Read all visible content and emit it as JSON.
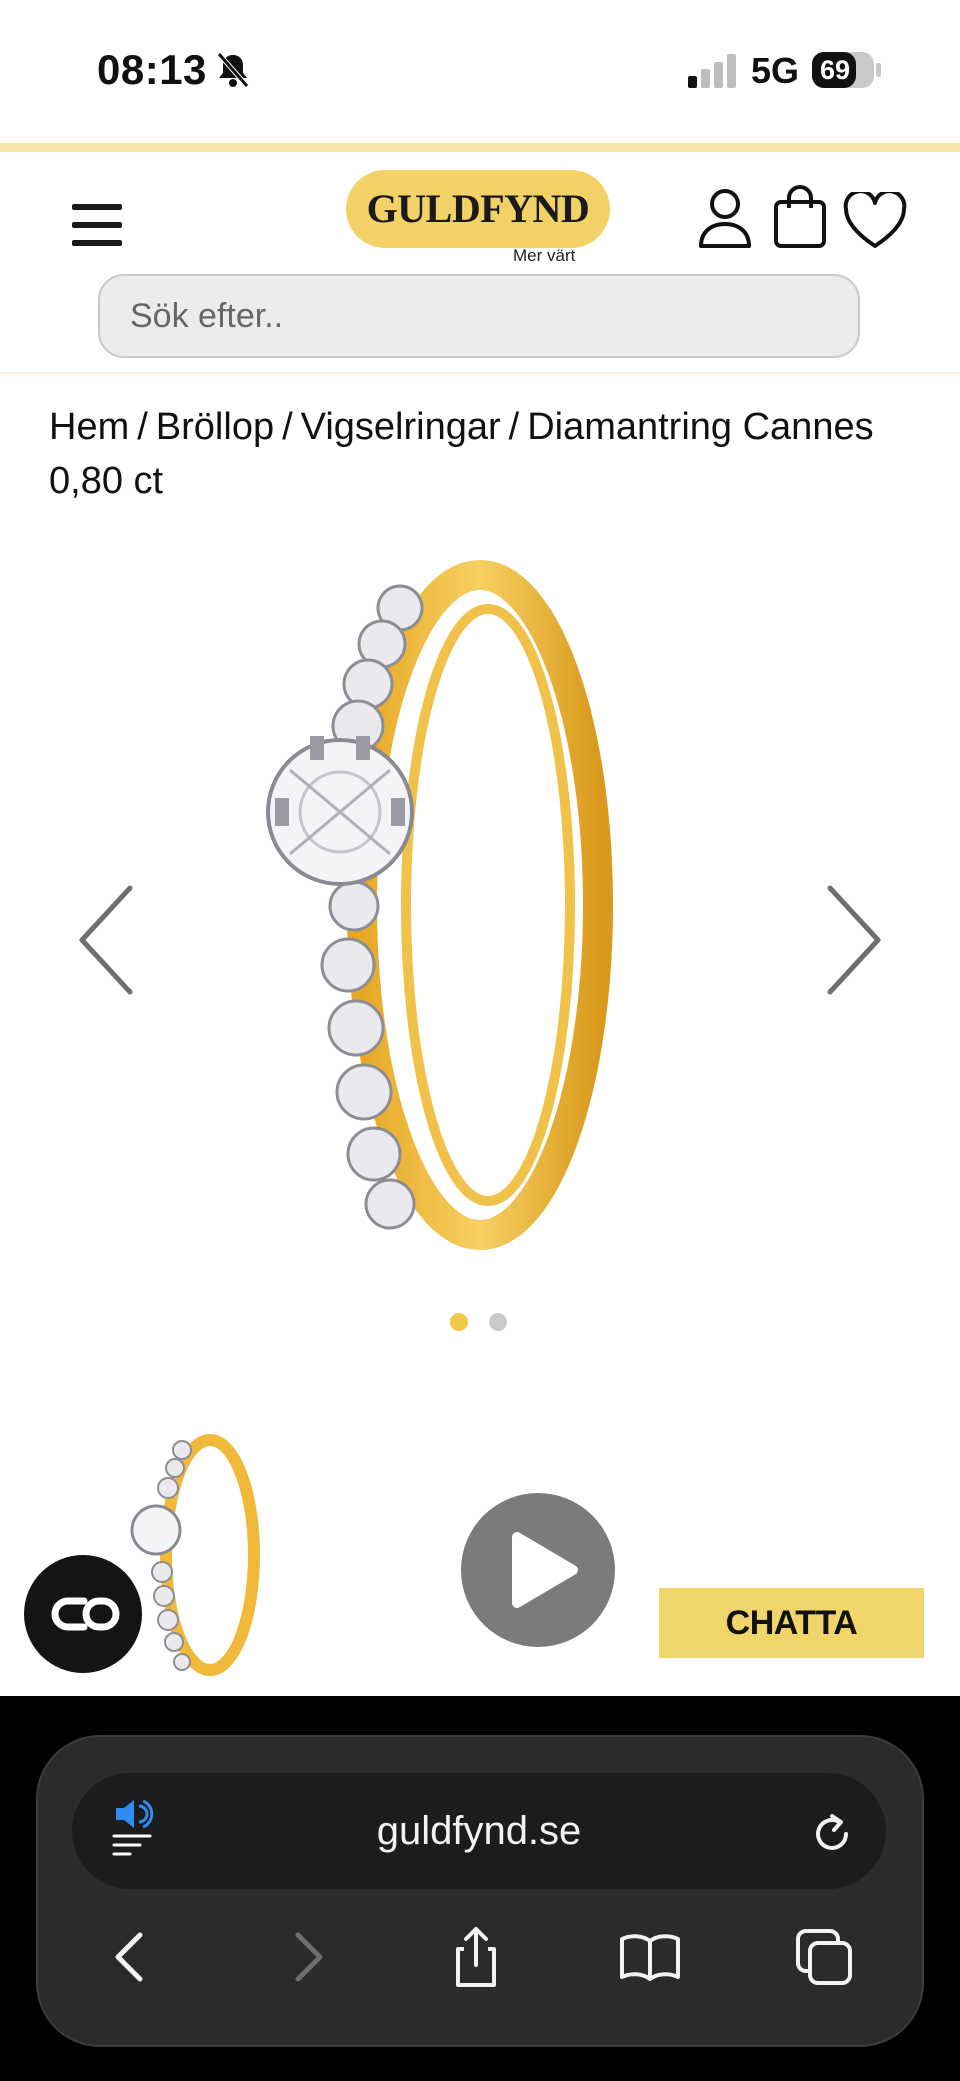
{
  "status_bar": {
    "time": "08:13",
    "network": "5G",
    "battery": "69"
  },
  "header": {
    "logo_text": "GULDFYND",
    "tagline": "Mer värt",
    "search_placeholder": "Sök efter.."
  },
  "breadcrumb": {
    "items": [
      "Hem",
      "Bröllop",
      "Vigselringar"
    ],
    "current": "Diamantring Cannes 0,80 ct",
    "separator": "/"
  },
  "gallery": {
    "slide_count": 2,
    "active_slide": 1
  },
  "chat": {
    "button_label": "CHATTA"
  },
  "browser": {
    "url": "guldfynd.se"
  },
  "colors": {
    "gold": "#f2d267",
    "dot_active": "#f2c84b",
    "dot_inactive": "#c9c9c9"
  }
}
